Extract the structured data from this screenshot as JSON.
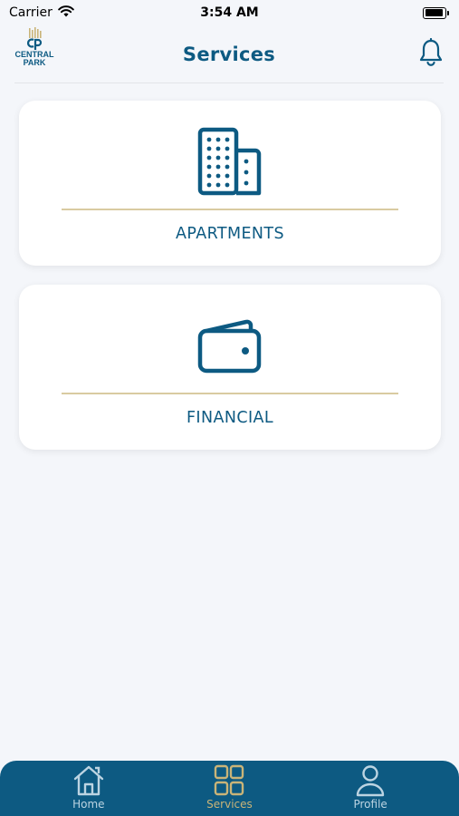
{
  "status_bar": {
    "carrier": "Carrier",
    "time": "3:54 AM",
    "battery_level": 0.95
  },
  "header": {
    "title": "Services",
    "logo_text_line1": "CENTRAL",
    "logo_text_line2": "PARK",
    "logo_monogram": "CP"
  },
  "cards": [
    {
      "label": "APARTMENTS",
      "icon": "buildings-icon"
    },
    {
      "label": "FINANCIAL",
      "icon": "wallet-icon"
    }
  ],
  "tabs": [
    {
      "label": "Home",
      "icon": "home-icon",
      "active": false
    },
    {
      "label": "Services",
      "icon": "grid-icon",
      "active": true
    },
    {
      "label": "Profile",
      "icon": "person-icon",
      "active": false
    }
  ],
  "colors": {
    "primary": "#0d5a82",
    "accent_gold": "#c9b478",
    "divider_gold": "#d9cba1",
    "background": "#f4f6fa"
  }
}
